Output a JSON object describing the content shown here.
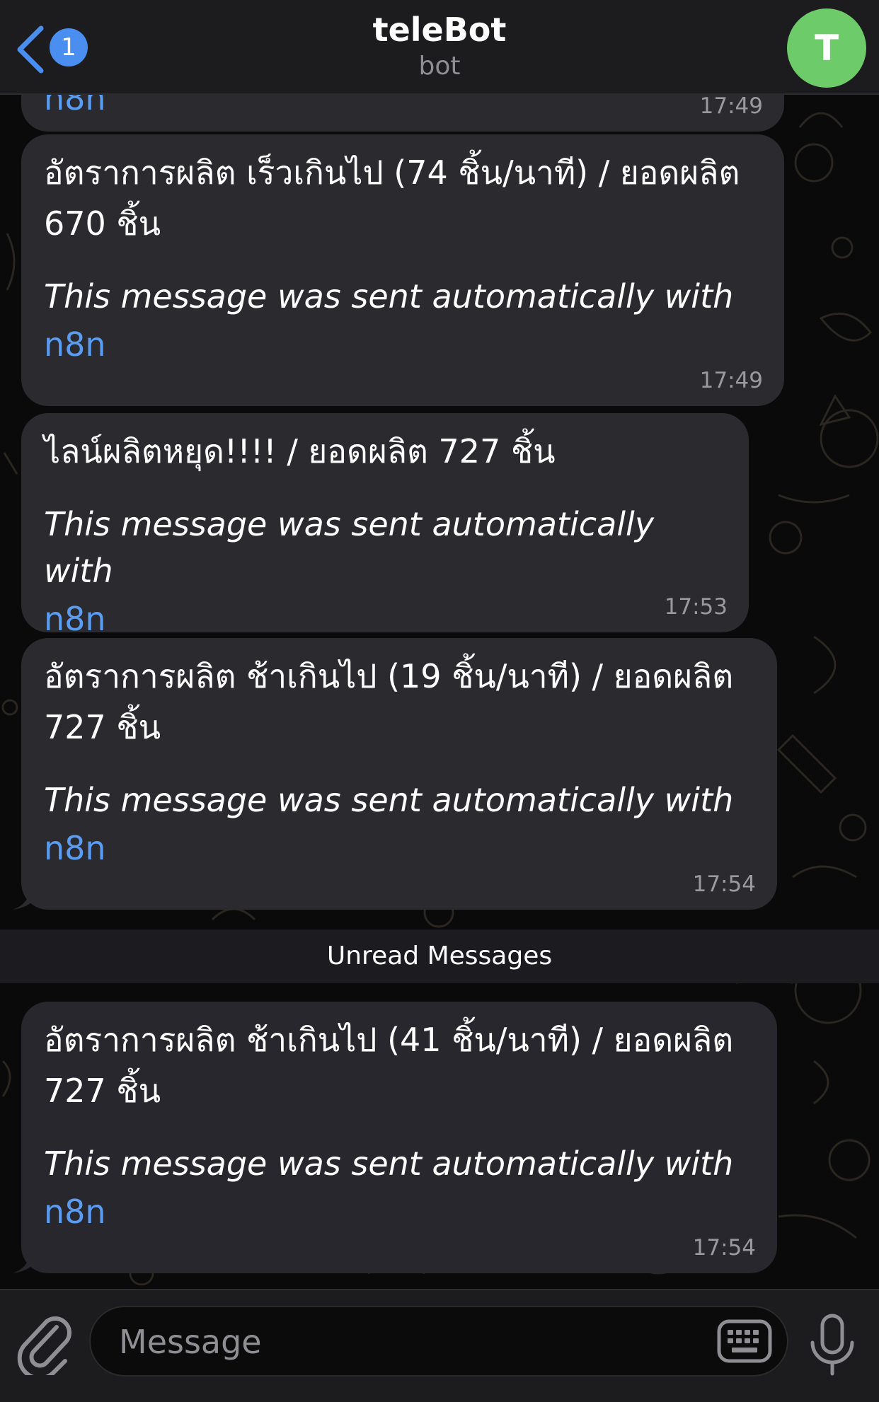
{
  "header": {
    "back_badge_count": "1",
    "title": "teleBot",
    "subtitle": "bot",
    "avatar_letter": "T",
    "avatar_color": "#6ecb6a",
    "back_icon": "chevron-left-icon"
  },
  "messages": [
    {
      "partial_link": "n8n",
      "time": "17:49"
    },
    {
      "text": "อัตราการผลิต เร็วเกินไป (74 ชิ้น/นาที) / ยอดผลิต\n670 ชิ้น",
      "auto_note": "This message was sent automatically with",
      "link": "n8n",
      "time": "17:49"
    },
    {
      "text": "ไลน์ผลิตหยุด!!!! / ยอดผลิต 727 ชิ้น",
      "auto_note": "This message was sent automatically with",
      "link": "n8n",
      "time": "17:53"
    },
    {
      "text": "อัตราการผลิต ช้าเกินไป (19 ชิ้น/นาที) / ยอดผลิต\n727 ชิ้น",
      "auto_note": "This message was sent automatically with",
      "link": "n8n",
      "time": "17:54"
    },
    {
      "text": "อัตราการผลิต ช้าเกินไป (41 ชิ้น/นาที) / ยอดผลิต\n727 ชิ้น",
      "auto_note": "This message was sent automatically with",
      "link": "n8n",
      "time": "17:54"
    }
  ],
  "unread_divider": "Unread Messages",
  "input_bar": {
    "placeholder": "Message",
    "attach_icon": "paperclip-icon",
    "keyboard_icon": "keyboard-icon",
    "mic_icon": "microphone-icon"
  },
  "colors": {
    "accent": "#5a9cf2",
    "badge": "#4a8ff0",
    "bubble": "#2b2a2e",
    "header": "#1c1c1e"
  }
}
